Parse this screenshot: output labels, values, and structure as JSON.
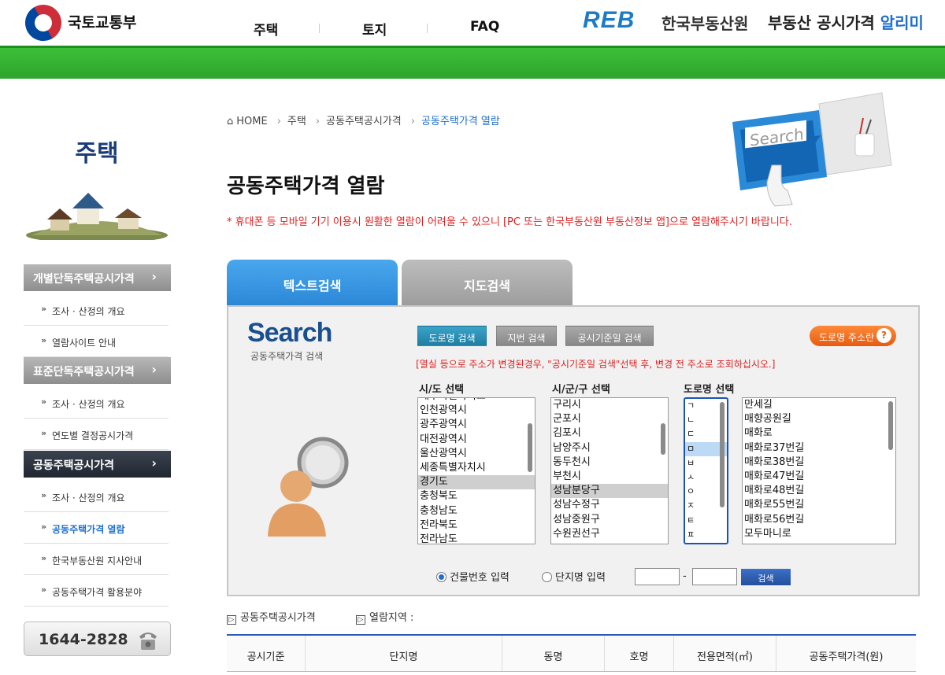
{
  "header": {
    "ministry_name": "국토교통부",
    "nav": [
      "주택",
      "토지",
      "FAQ"
    ],
    "reb_logo": "REB",
    "reb_name": "한국부동산원",
    "site_name_plain": "부동산 공시가격 ",
    "site_name_accent": "알리미"
  },
  "sidebar": {
    "title": "주택",
    "groups": [
      {
        "label": "개별단독주택공시가격",
        "items": [
          "조사 · 산정의 개요",
          "열람사이트 안내"
        ]
      },
      {
        "label": "표준단독주택공시가격",
        "items": [
          "조사 · 산정의 개요",
          "연도별 결정공시가격"
        ]
      },
      {
        "label": "공동주택공시가격",
        "items": [
          "조사 · 산정의 개요",
          "공동주택가격 열람",
          "한국부동산원 지사안내",
          "공동주택가격 활용분야"
        ]
      }
    ],
    "phone": "1644-2828"
  },
  "breadcrumb": [
    "HOME",
    "주택",
    "공동주택공시가격",
    "공동주택가격 열람"
  ],
  "page_title": "공동주택가격 열람",
  "notice": "* 휴대폰 등 모바일 기기 이용시 원활한 열람이 어려울 수 있으니 [PC 또는 한국부동산원 부동산정보 앱]으로 열람해주시기 바랍니다.",
  "hero_search_text": "Search",
  "tabs": [
    "텍스트검색",
    "지도검색"
  ],
  "search": {
    "logo": "Search",
    "logo_sub": "공동주택가격 검색",
    "buttons": [
      "도로명 검색",
      "지번 검색",
      "공시기준일 검색"
    ],
    "road_list_button": "도로명 주소란",
    "road_list_q": "?",
    "notice": "[멸실 등으로 주소가 변경된경우, \"공시기준일 검색\"선택 후, 변경 전 주소로 조회하십시오.]",
    "columns": [
      "시/도 선택",
      "시/군/구 선택",
      "도로명 선택"
    ],
    "sido": [
      "제주특별자치도",
      "인천광역시",
      "광주광역시",
      "대전광역시",
      "울산광역시",
      "세종특별자치시",
      "경기도",
      "충청북도",
      "충청남도",
      "전라북도",
      "전라남도"
    ],
    "sido_selected": "경기도",
    "sigungu": [
      "구리시",
      "군포시",
      "김포시",
      "남양주시",
      "동두천시",
      "부천시",
      "성남분당구",
      "성남수정구",
      "성남중원구",
      "수원권선구"
    ],
    "sigungu_selected": "성남분당구",
    "initials": [
      "ㄱ",
      "ㄴ",
      "ㄷ",
      "ㅁ",
      "ㅂ",
      "ㅅ",
      "ㅇ",
      "ㅈ",
      "ㅌ",
      "ㅍ"
    ],
    "initial_selected": "ㅁ",
    "roads": [
      "만세길",
      "매향공원길",
      "매화로",
      "매화로37번길",
      "매화로38번길",
      "매화로47번길",
      "매화로48번길",
      "매화로55번길",
      "매화로56번길",
      "모두마니로"
    ],
    "radio_building": "건물번호 입력",
    "radio_complex": "단지명 입력",
    "dash": "-",
    "search_button": "검색"
  },
  "result": {
    "links": [
      "공동주택공시가격",
      "열람지역 :"
    ],
    "link_icon": "▷",
    "headers": [
      "공시기준",
      "단지명",
      "동명",
      "호명",
      "전용면적(㎡)",
      "공동주택가격(원)"
    ]
  }
}
